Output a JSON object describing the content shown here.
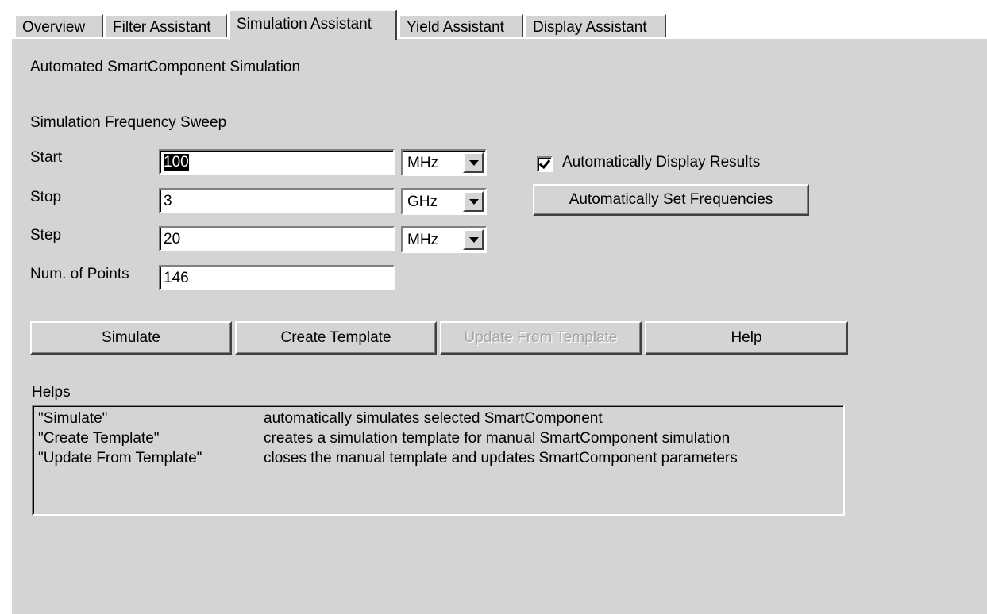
{
  "tabs": [
    {
      "label": "Overview",
      "active": false
    },
    {
      "label": "Filter Assistant",
      "active": false
    },
    {
      "label": "Simulation Assistant",
      "active": true
    },
    {
      "label": "Yield Assistant",
      "active": false
    },
    {
      "label": "Display Assistant",
      "active": false
    }
  ],
  "panel": {
    "title": "Automated SmartComponent Simulation",
    "sweep_heading": "Simulation Frequency Sweep"
  },
  "sweep": {
    "start": {
      "label": "Start",
      "value": "100",
      "unit": "MHz"
    },
    "stop": {
      "label": "Stop",
      "value": "3",
      "unit": "GHz"
    },
    "step": {
      "label": "Step",
      "value": "20",
      "unit": "MHz"
    },
    "points": {
      "label": "Num. of Points",
      "value": "146"
    }
  },
  "options": {
    "auto_display_label": "Automatically Display Results",
    "auto_display_checked": true,
    "auto_set_freq_label": "Automatically Set Frequencies"
  },
  "actions": {
    "simulate": "Simulate",
    "create_template": "Create Template",
    "update_from_template": "Update From Template",
    "help": "Help"
  },
  "helps": {
    "heading": "Helps",
    "rows": [
      {
        "key": "\"Simulate\"",
        "desc": "automatically simulates selected SmartComponent"
      },
      {
        "key": "\"Create Template\"",
        "desc": "creates a simulation template for manual SmartComponent simulation"
      },
      {
        "key": "\"Update From Template\"",
        "desc": "closes the manual template and updates SmartComponent parameters"
      }
    ]
  }
}
